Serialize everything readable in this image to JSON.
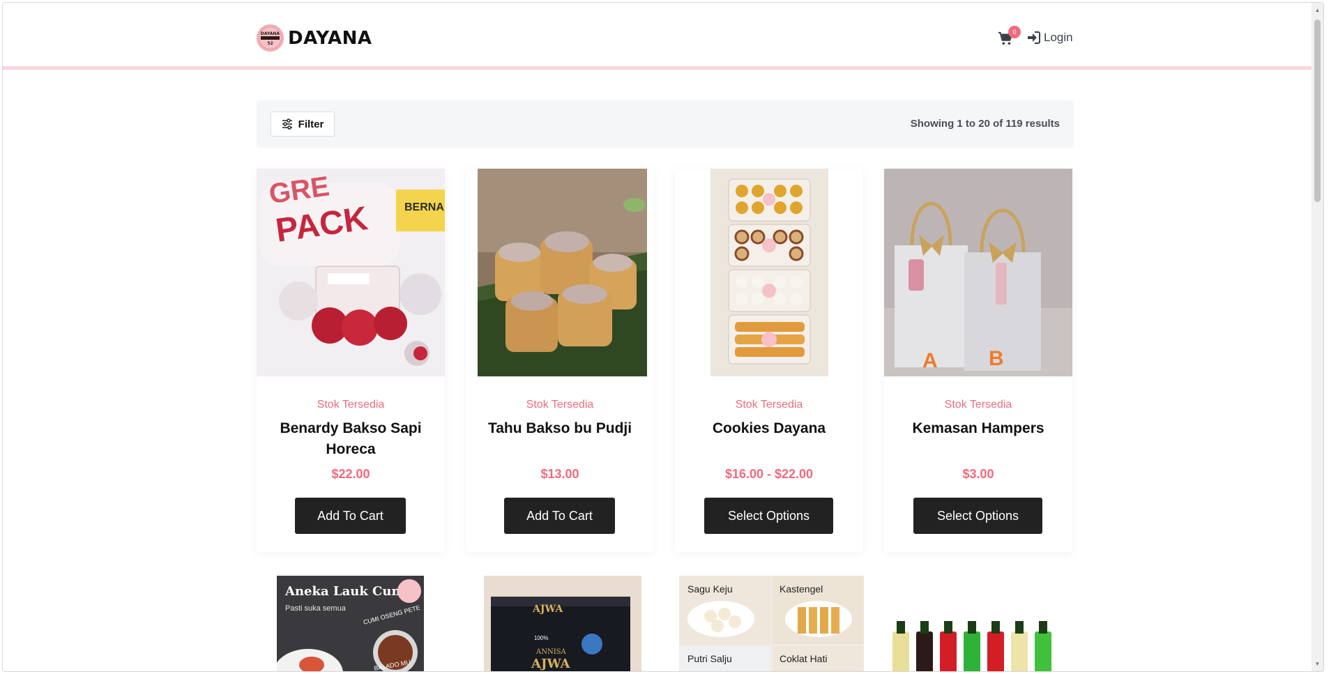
{
  "brand": {
    "name": "DAYANA",
    "badge_text": "DAYANA FOOD 52"
  },
  "header": {
    "cart_count": "0",
    "login_label": "Login"
  },
  "toolbar": {
    "filter_label": "Filter",
    "results_text": "Showing 1 to 20 of 119 results"
  },
  "products": [
    {
      "stock": "Stok Tersedia",
      "name": "Benardy Bakso Sapi Horeca",
      "price": "$22.00",
      "button": "Add To Cart"
    },
    {
      "stock": "Stok Tersedia",
      "name": "Tahu Bakso bu Pudji",
      "price": "$13.00",
      "button": "Add To Cart"
    },
    {
      "stock": "Stok Tersedia",
      "name": "Cookies Dayana",
      "price": "$16.00 - $22.00",
      "button": "Select Options"
    },
    {
      "stock": "Stok Tersedia",
      "name": "Kemasan Hampers",
      "price": "$3.00",
      "button": "Select Options"
    }
  ],
  "row2_images": {
    "cumi": {
      "title": "Aneka Lauk Cumi",
      "subtitle": "Pasti suka semua",
      "tag": "CUMI OSENG PETE",
      "tag2": "BALADO MU"
    },
    "ajwa": {
      "brand": "AJWA",
      "sub": "ANNISA",
      "badge": "100%"
    },
    "cookies_grid": [
      "Sagu Keju",
      "Kastengel",
      "Putri Salju",
      "Coklat Hati"
    ]
  },
  "colors": {
    "accent": "#f06b7c",
    "header_border": "#fbd5d9",
    "button_dark": "#222222",
    "toolbar_bg": "#f5f6f8"
  }
}
